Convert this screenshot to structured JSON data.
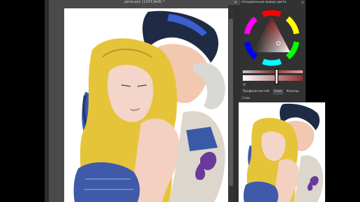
{
  "window": {
    "title": "дело-рук (1243,9мб) *",
    "close_glyph": "×"
  },
  "docker": {
    "title": "Расширенный выбор цвета",
    "close_glyph": "×",
    "tabs": [
      {
        "label": "Профили кистей"
      },
      {
        "label": "Слои"
      },
      {
        "label": "Каналы"
      }
    ],
    "section_label": "Слои",
    "settings_glyph": "⚙"
  },
  "colors": {
    "app_bg": "#3a3a3a",
    "selected_color": "#c87878",
    "triangle_top": "#d03030"
  }
}
